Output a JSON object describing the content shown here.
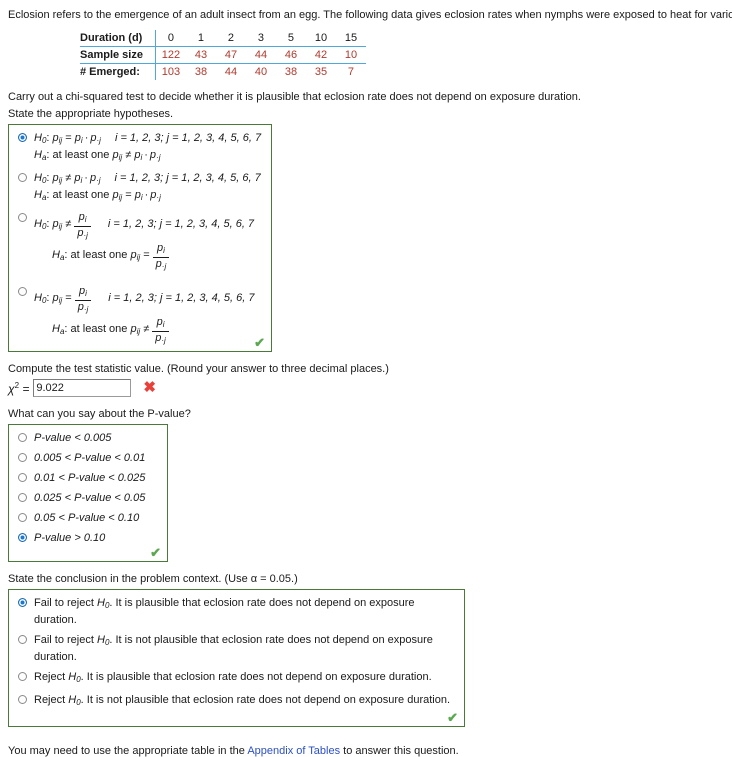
{
  "intro": "Eclosion refers to the emergence of an adult insect from an egg. The following data gives eclosion rates when nymphs were exposed to heat for various durations.",
  "data_table": {
    "row_labels": [
      "Duration (d)",
      "Sample size",
      "# Emerged:"
    ],
    "durations": [
      "0",
      "1",
      "2",
      "3",
      "5",
      "10",
      "15"
    ],
    "sample_size": [
      "122",
      "43",
      "47",
      "44",
      "46",
      "42",
      "10"
    ],
    "emerged": [
      "103",
      "38",
      "44",
      "40",
      "38",
      "35",
      "7"
    ]
  },
  "task": {
    "line1": "Carry out a chi-squared test to decide whether it is plausible that eclosion rate does not depend on exposure duration.",
    "line2": "State the appropriate hypotheses."
  },
  "hypotheses": {
    "index_text": "i = 1, 2, 3; j = 1, 2, 3, 4, 5, 6, 7",
    "at_least_one": "at least one",
    "options": [
      {
        "id": "hypo-option-1",
        "selected": true,
        "null_rel": "=",
        "alt_rel": "≠",
        "form": "product"
      },
      {
        "id": "hypo-option-2",
        "selected": false,
        "null_rel": "≠",
        "alt_rel": "=",
        "form": "product"
      },
      {
        "id": "hypo-option-3",
        "selected": false,
        "null_rel": "≠",
        "alt_rel": "=",
        "form": "fraction"
      },
      {
        "id": "hypo-option-4",
        "selected": false,
        "null_rel": "=",
        "alt_rel": "≠",
        "form": "fraction"
      }
    ],
    "checkmark": "✔"
  },
  "test_statistic": {
    "prompt": "Compute the test statistic value. (Round your answer to three decimal places.)",
    "label": "χ",
    "exponent": "2",
    "equals": "=",
    "value": "9.022",
    "status_icon": "✖"
  },
  "pvalue": {
    "prompt": "What can you say about the P-value?",
    "options": [
      {
        "label": "P-value < 0.005",
        "selected": false
      },
      {
        "label": "0.005 < P-value < 0.01",
        "selected": false
      },
      {
        "label": "0.01 < P-value < 0.025",
        "selected": false
      },
      {
        "label": "0.025 < P-value < 0.05",
        "selected": false
      },
      {
        "label": "0.05 < P-value < 0.10",
        "selected": false
      },
      {
        "label": "P-value > 0.10",
        "selected": true
      }
    ],
    "checkmark": "✔"
  },
  "conclusion": {
    "prompt": "State the conclusion in the problem context. (Use α = 0.05.)",
    "options": [
      {
        "lead": "Fail to reject",
        "tail": ". It is plausible that eclosion rate does not depend on exposure duration.",
        "selected": true
      },
      {
        "lead": "Fail to reject",
        "tail": ". It is not plausible that eclosion rate does not depend on exposure duration.",
        "selected": false
      },
      {
        "lead": "Reject",
        "tail": ". It is plausible that eclosion rate does not depend on exposure duration.",
        "selected": false
      },
      {
        "lead": "Reject",
        "tail": ". It is not plausible that eclosion rate does not depend on exposure duration.",
        "selected": false
      }
    ],
    "h0_symbol": "H",
    "h0_sub": "0",
    "checkmark": "✔"
  },
  "footer": {
    "before": "You may need to use the appropriate table in the ",
    "link": "Appendix of Tables",
    "after": " to answer this question."
  }
}
